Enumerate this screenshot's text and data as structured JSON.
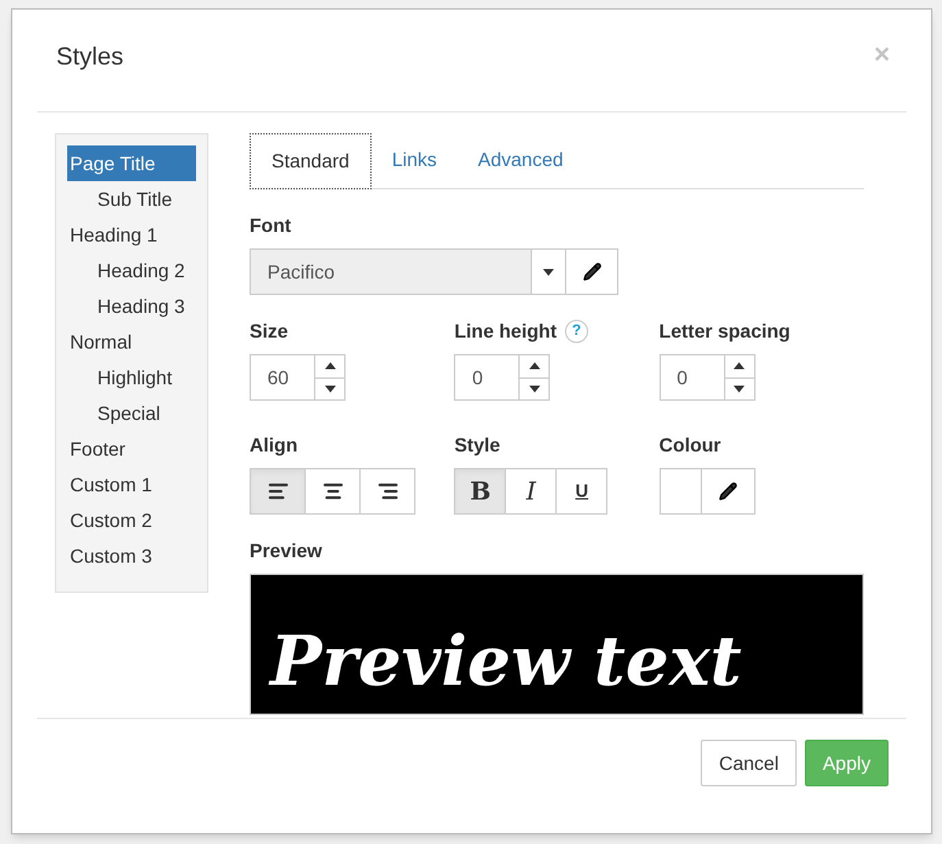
{
  "dialog": {
    "title": "Styles",
    "close": "×"
  },
  "styles_list": [
    {
      "label": "Page Title",
      "selected": true,
      "children": [
        {
          "label": "Sub Title",
          "selected": false
        }
      ]
    },
    {
      "label": "Heading 1",
      "selected": false,
      "children": [
        {
          "label": "Heading 2",
          "selected": false
        },
        {
          "label": "Heading 3",
          "selected": false
        }
      ]
    },
    {
      "label": "Normal",
      "selected": false,
      "children": [
        {
          "label": "Highlight",
          "selected": false
        },
        {
          "label": "Special",
          "selected": false
        }
      ]
    },
    {
      "label": "Footer",
      "selected": false
    },
    {
      "label": "Custom 1",
      "selected": false
    },
    {
      "label": "Custom 2",
      "selected": false
    },
    {
      "label": "Custom 3",
      "selected": false
    }
  ],
  "tabs": [
    {
      "label": "Standard",
      "selected": true
    },
    {
      "label": "Links",
      "selected": false
    },
    {
      "label": "Advanced",
      "selected": false
    }
  ],
  "font": {
    "label": "Font",
    "value": "Pacifico"
  },
  "spinners": [
    {
      "label": "Size",
      "value": "60"
    },
    {
      "label": "Line height",
      "value": "0",
      "help_mark": "?"
    },
    {
      "label": "Letter spacing",
      "value": "0"
    }
  ],
  "align": {
    "label": "Align",
    "options": [
      {
        "kind": "left",
        "selected": true
      },
      {
        "kind": "center",
        "selected": false
      },
      {
        "kind": "right",
        "selected": false
      }
    ]
  },
  "style": {
    "label": "Style",
    "options": [
      {
        "kind": "bold",
        "text": "B",
        "selected": true
      },
      {
        "kind": "italic",
        "text": "I",
        "selected": false
      },
      {
        "kind": "underline",
        "text": "U",
        "selected": false
      }
    ]
  },
  "colour": {
    "label": "Colour",
    "color": "#ffffff"
  },
  "preview": {
    "label": "Preview",
    "text": "Preview text"
  },
  "buttons": [
    {
      "kind": "cancel",
      "label": "Cancel"
    },
    {
      "kind": "apply",
      "label": "Apply"
    }
  ]
}
